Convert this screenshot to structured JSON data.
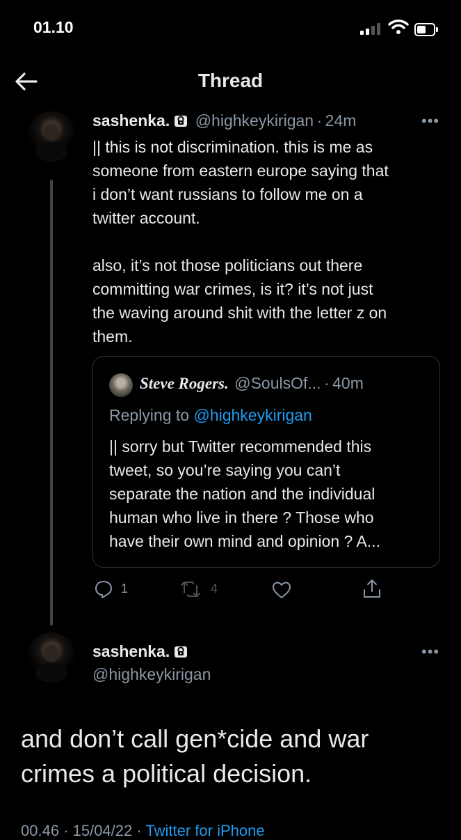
{
  "status_bar": {
    "time": "01.10"
  },
  "header": {
    "title": "Thread"
  },
  "tweet1": {
    "name": "sashenka.",
    "handle": "@highkeykirigan",
    "sep": "·",
    "time": "24m",
    "more": "•••",
    "text": "|| this is not discrimination. this is me as\nsomeone from eastern europe saying that\ni don’t want russians to follow me on a\ntwitter account.\n\nalso, it’s not those politicians out there\ncommitting war crimes, is it? it’s not just\nthe waving around shit with the letter z on\nthem.",
    "quote": {
      "name": "Steve Rogers.",
      "handle": "@SoulsOf...",
      "sep": "·",
      "time": "40m",
      "replying_prefix": "Replying to",
      "replying_handle": "@highkeykirigan",
      "text": "|| sorry but Twitter recommended this\ntweet, so you’re saying you can’t\nseparate the nation and the individual\nhuman who live in there ? Those who\nhave their own mind and opinion ? A..."
    },
    "actions": {
      "replies": "1",
      "retweets": "4"
    }
  },
  "tweet2": {
    "name": "sashenka.",
    "handle": "@highkeykirigan",
    "more": "•••",
    "text": "and don’t call gen*cide and war\ncrimes a political decision.",
    "time": "00.46 · 15/04/22 ·",
    "source": "Twitter for iPhone"
  },
  "colors": {
    "background": "#000000",
    "link": "#1d9bf0",
    "muted": "#8b98a5"
  }
}
